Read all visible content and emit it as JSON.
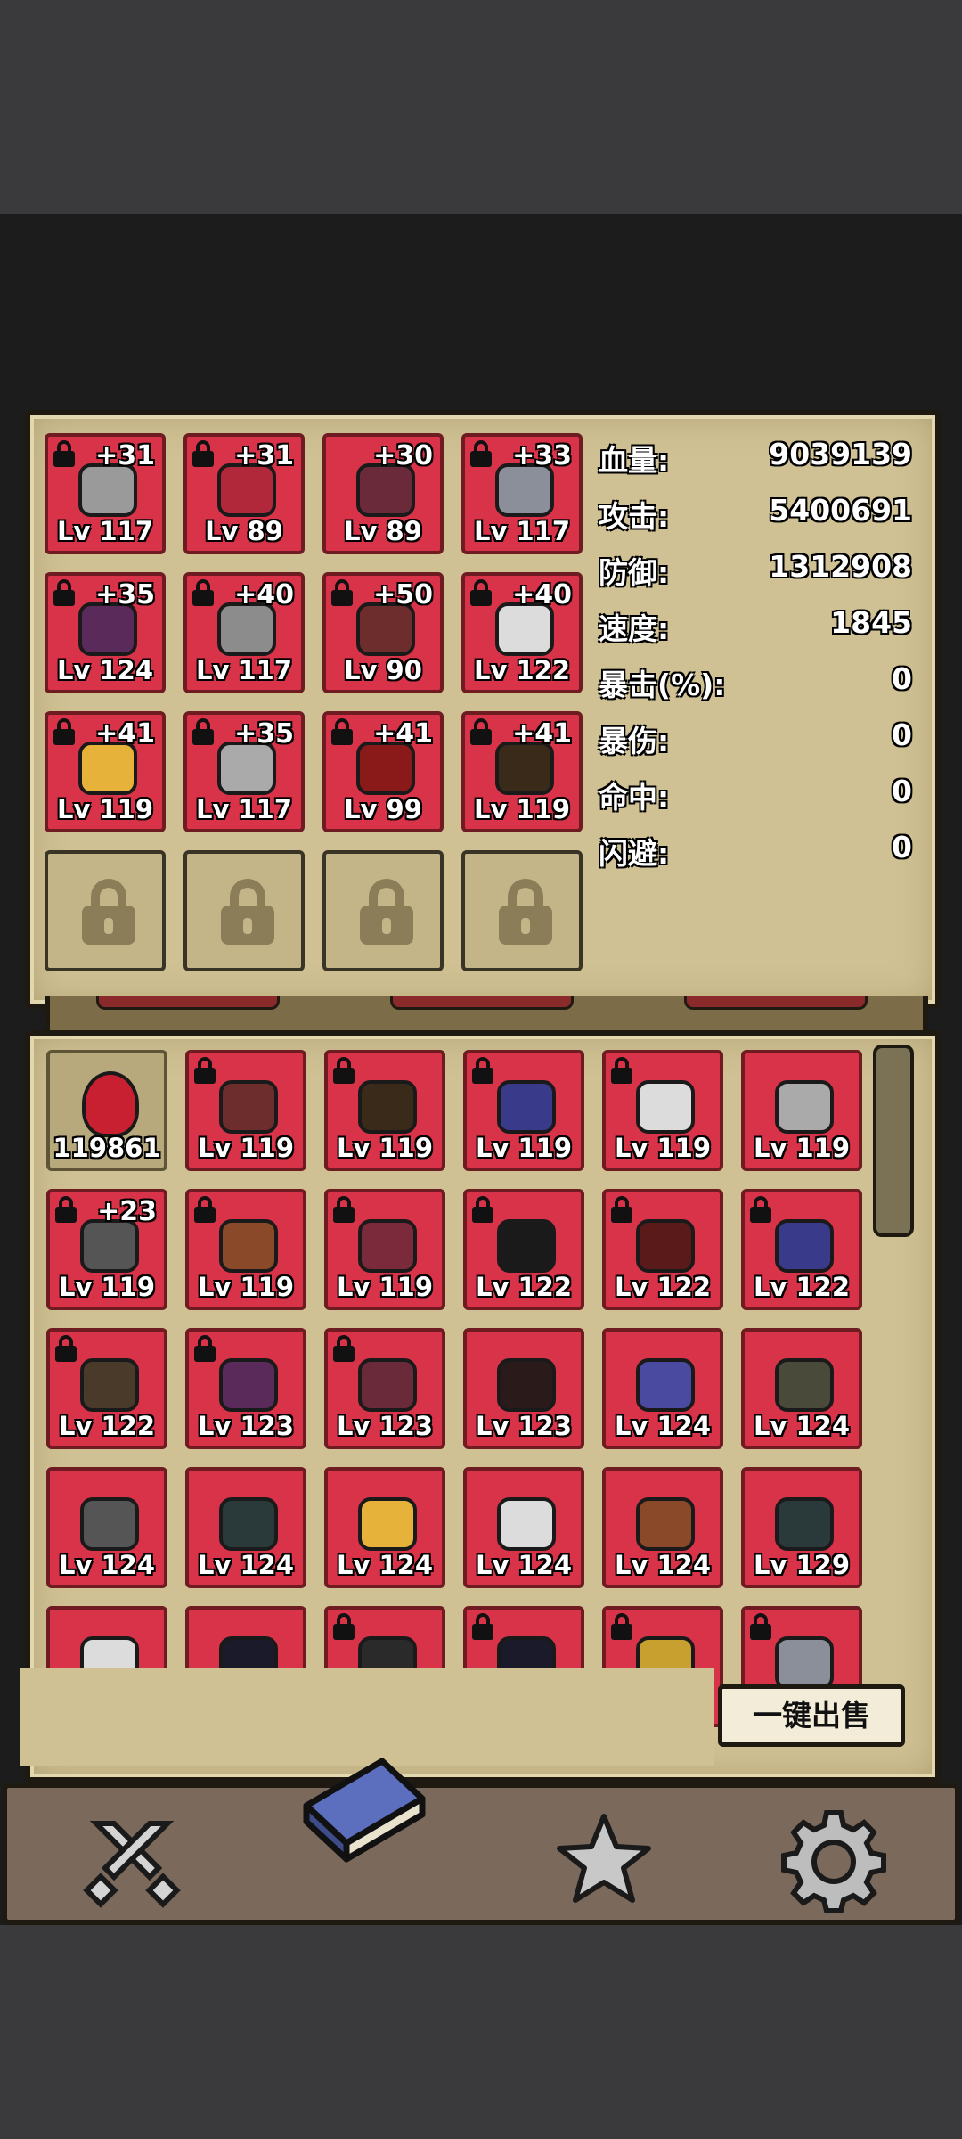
{
  "equipped": [
    {
      "plus": "+31",
      "lv": "Lv 117",
      "locked": true,
      "color": "#9a9a9a"
    },
    {
      "plus": "+31",
      "lv": "Lv 89",
      "locked": true,
      "color": "#b0283a"
    },
    {
      "plus": "+30",
      "lv": "Lv 89",
      "locked": false,
      "color": "#6a2a3a"
    },
    {
      "plus": "+33",
      "lv": "Lv 117",
      "locked": true,
      "color": "#8a8f99"
    },
    {
      "plus": "+35",
      "lv": "Lv 124",
      "locked": true,
      "color": "#5a2a5a"
    },
    {
      "plus": "+40",
      "lv": "Lv 117",
      "locked": true,
      "color": "#8c8c8c"
    },
    {
      "plus": "+50",
      "lv": "Lv 90",
      "locked": true,
      "color": "#6e2d2d"
    },
    {
      "plus": "+40",
      "lv": "Lv 122",
      "locked": true,
      "color": "#dcdcdc"
    },
    {
      "plus": "+41",
      "lv": "Lv 119",
      "locked": true,
      "color": "#e6b23a"
    },
    {
      "plus": "+35",
      "lv": "Lv 117",
      "locked": true,
      "color": "#aaaaaa"
    },
    {
      "plus": "+41",
      "lv": "Lv 99",
      "locked": true,
      "color": "#8a1a1a"
    },
    {
      "plus": "+41",
      "lv": "Lv 119",
      "locked": true,
      "color": "#3a2a1a"
    }
  ],
  "stats": [
    {
      "label": "血量:",
      "value": "9039139"
    },
    {
      "label": "攻击:",
      "value": "5400691"
    },
    {
      "label": "防御:",
      "value": "1312908"
    },
    {
      "label": "速度:",
      "value": "1845"
    },
    {
      "label": "暴击(%):",
      "value": "0"
    },
    {
      "label": "暴伤:",
      "value": "0"
    },
    {
      "label": "命中:",
      "value": "0"
    },
    {
      "label": "闪避:",
      "value": "0"
    }
  ],
  "inventory": [
    {
      "plus": "",
      "lv": "119861",
      "locked": false,
      "potion": true,
      "color": "#c82030"
    },
    {
      "plus": "",
      "lv": "Lv 119",
      "locked": true,
      "color": "#6e2d2d"
    },
    {
      "plus": "",
      "lv": "Lv 119",
      "locked": true,
      "color": "#3a2a1a"
    },
    {
      "plus": "",
      "lv": "Lv 119",
      "locked": true,
      "color": "#3a3a8a"
    },
    {
      "plus": "",
      "lv": "Lv 119",
      "locked": true,
      "color": "#dcdcdc"
    },
    {
      "plus": "",
      "lv": "Lv 119",
      "locked": false,
      "color": "#aaaaaa"
    },
    {
      "plus": "+23",
      "lv": "Lv 119",
      "locked": true,
      "color": "#555555"
    },
    {
      "plus": "",
      "lv": "Lv 119",
      "locked": true,
      "color": "#8a4a2a"
    },
    {
      "plus": "",
      "lv": "Lv 119",
      "locked": true,
      "color": "#7a2a3a"
    },
    {
      "plus": "",
      "lv": "Lv 122",
      "locked": true,
      "color": "#1a1a1a"
    },
    {
      "plus": "",
      "lv": "Lv 122",
      "locked": true,
      "color": "#5a1a1a"
    },
    {
      "plus": "",
      "lv": "Lv 122",
      "locked": true,
      "color": "#3a3a8a"
    },
    {
      "plus": "",
      "lv": "Lv 122",
      "locked": true,
      "color": "#4a3a2a"
    },
    {
      "plus": "",
      "lv": "Lv 123",
      "locked": true,
      "color": "#5a2a5a"
    },
    {
      "plus": "",
      "lv": "Lv 123",
      "locked": true,
      "color": "#6a2a3a"
    },
    {
      "plus": "",
      "lv": "Lv 123",
      "locked": false,
      "color": "#2a1a1a"
    },
    {
      "plus": "",
      "lv": "Lv 124",
      "locked": false,
      "color": "#4a4aa0"
    },
    {
      "plus": "",
      "lv": "Lv 124",
      "locked": false,
      "color": "#4a4a3a"
    },
    {
      "plus": "",
      "lv": "Lv 124",
      "locked": false,
      "color": "#555555"
    },
    {
      "plus": "",
      "lv": "Lv 124",
      "locked": false,
      "color": "#2a3a3a"
    },
    {
      "plus": "",
      "lv": "Lv 124",
      "locked": false,
      "color": "#e6b23a"
    },
    {
      "plus": "",
      "lv": "Lv 124",
      "locked": false,
      "color": "#dcdcdc"
    },
    {
      "plus": "",
      "lv": "Lv 124",
      "locked": false,
      "color": "#8a4a2a"
    },
    {
      "plus": "",
      "lv": "Lv 129",
      "locked": false,
      "color": "#2a3a3a"
    },
    {
      "plus": "",
      "lv": "",
      "locked": false,
      "color": "#dcdcdc"
    },
    {
      "plus": "",
      "lv": "",
      "locked": false,
      "color": "#1a1a2a"
    },
    {
      "plus": "",
      "lv": "",
      "locked": true,
      "color": "#2a2a2a"
    },
    {
      "plus": "",
      "lv": "",
      "locked": true,
      "color": "#1a1a2a"
    },
    {
      "plus": "",
      "lv": "",
      "locked": true,
      "color": "#c8a030"
    },
    {
      "plus": "",
      "lv": "",
      "locked": true,
      "color": "#8a8f99"
    }
  ],
  "sell_all_label": "一键出售",
  "nav": [
    {
      "name": "battle-icon"
    },
    {
      "name": "backpack-book-icon"
    },
    {
      "name": "star-icon"
    },
    {
      "name": "settings-gear-icon"
    }
  ]
}
